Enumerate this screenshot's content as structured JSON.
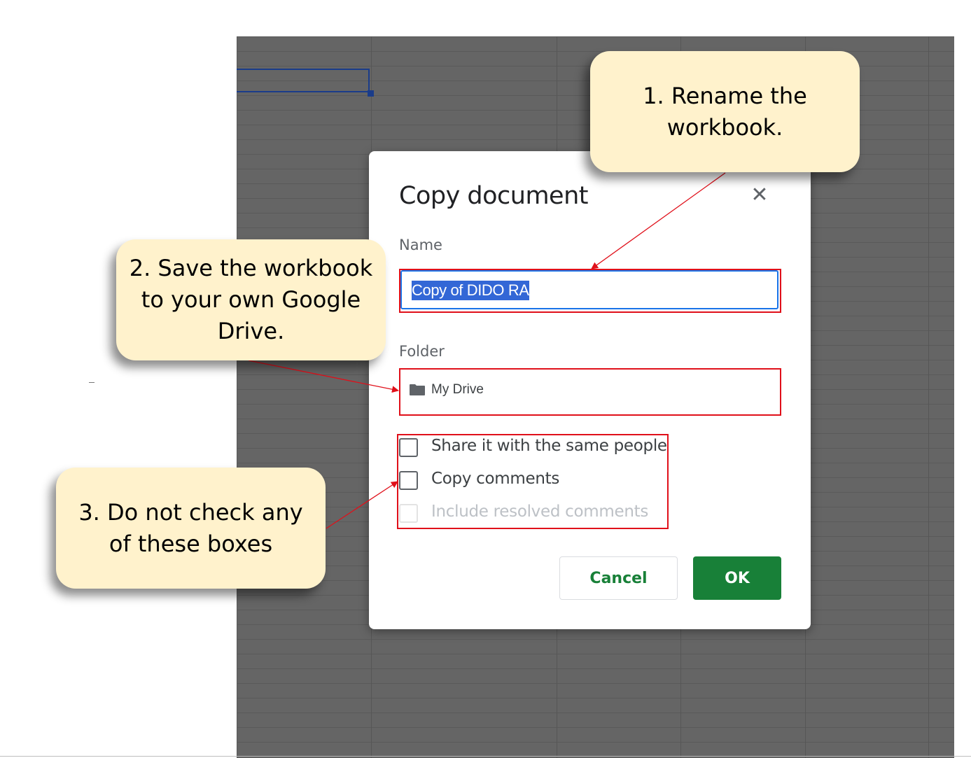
{
  "dialog": {
    "title": "Copy document",
    "close_icon": "close-icon",
    "name_label": "Name",
    "name_value": "Copy of DIDO RA",
    "folder_label": "Folder",
    "folder_icon": "folder-icon",
    "folder_value": "My Drive",
    "options": [
      {
        "label": "Share it with the same people",
        "checked": false,
        "disabled": false
      },
      {
        "label": "Copy comments",
        "checked": false,
        "disabled": false
      },
      {
        "label": "Include resolved comments",
        "checked": false,
        "disabled": true
      }
    ],
    "cancel_label": "Cancel",
    "ok_label": "OK"
  },
  "callouts": [
    {
      "lines": [
        "1. Rename the",
        "workbook."
      ]
    },
    {
      "lines": [
        "2. Save the workbook",
        "to your own Google",
        "Drive."
      ]
    },
    {
      "lines": [
        "3. Do not check any",
        "of these boxes"
      ]
    }
  ],
  "colors": {
    "accent_green": "#188038",
    "highlight_red": "#e0101a",
    "callout_fill": "#fff2cc",
    "selection_blue": "#3367d6"
  }
}
